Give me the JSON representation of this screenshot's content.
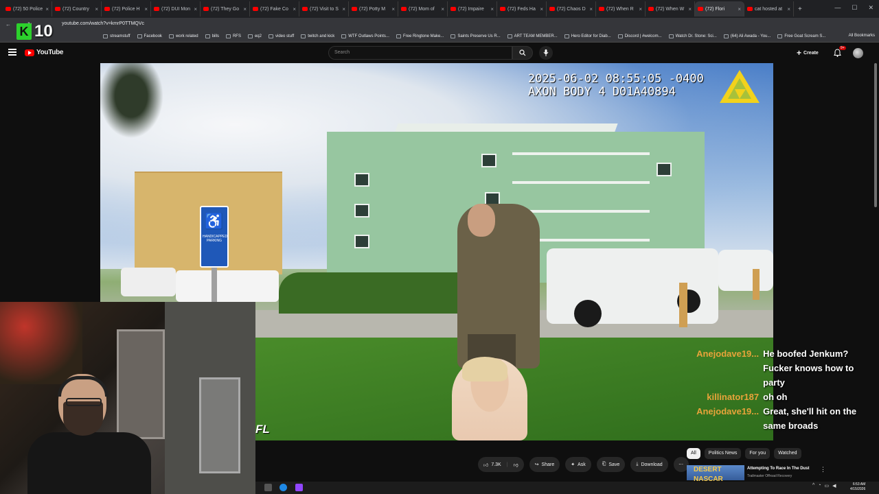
{
  "browser": {
    "tabs": [
      {
        "label": "(72) 50 Police",
        "active": false
      },
      {
        "label": "(72) Country",
        "active": false
      },
      {
        "label": "(72) Police H",
        "active": false
      },
      {
        "label": "(72) DUI Mon",
        "active": false
      },
      {
        "label": "(72) They Go",
        "active": false
      },
      {
        "label": "(72) Fake Co",
        "active": false
      },
      {
        "label": "(72) Visit to S",
        "active": false
      },
      {
        "label": "(72) Potty M",
        "active": false
      },
      {
        "label": "(72) Mom of",
        "active": false
      },
      {
        "label": "(72) Impaire",
        "active": false
      },
      {
        "label": "(72) Feds Ha",
        "active": false
      },
      {
        "label": "(72) Chaos D",
        "active": false
      },
      {
        "label": "(72) When R",
        "active": false
      },
      {
        "label": "(72) When W",
        "active": false
      },
      {
        "label": "(72) Flori",
        "active": true
      },
      {
        "label": "cat hosted at",
        "active": false
      }
    ],
    "url": "youtube.com/watch?v=kmrP0TTMQVc",
    "bookmarks": [
      "streamstuff",
      "Facebook",
      "work related",
      "bills",
      "RFS",
      "eq2",
      "video stuff",
      "twitch and kick",
      "WTF Outlaws Points...",
      "Free Ringtone Make...",
      "Saints Preserve Us R...",
      "ART TEAM MEMBER...",
      "Hero Editor for Diab...",
      "Discord | #welcom...",
      "Watch Dr. Stone: Sci...",
      "(64) Ali Awada - You...",
      "Free Goat Scream S..."
    ],
    "all_bookmarks": "All Bookmarks"
  },
  "youtube": {
    "logo": "YouTube",
    "search_placeholder": "Search",
    "create_label": "Create",
    "notif_count": "9+"
  },
  "video": {
    "timestamp": "2025-06-02 08:55:05 -0400",
    "device": "AXON BODY 4 D01A40894",
    "overlay_state": "FL",
    "sign_text": "HANDICAPPED PARKING"
  },
  "stream": {
    "channel_badge": "K",
    "channel_number": "10"
  },
  "chat": [
    {
      "name": "Anejodave19...",
      "name_color": "#e8a33a",
      "message": "He boofed Jenkum?"
    },
    {
      "name": "",
      "name_color": "#e8a33a",
      "message": "Fucker knows how to party"
    },
    {
      "name": "killinator187",
      "name_color": "#e8a33a",
      "message": "oh oh"
    },
    {
      "name": "Anejodave19...",
      "name_color": "#e8a33a",
      "message": "Great, she'll hit on the same broads"
    }
  ],
  "actions": {
    "likes": "7.3K",
    "share": "Share",
    "ask": "Ask",
    "save": "Save",
    "download": "Download"
  },
  "chips": [
    "All",
    "Politics News",
    "For you",
    "Watched"
  ],
  "recommendation": {
    "thumb_text": "DESERT NASCAR",
    "title": "Attempting To Race In The Dust",
    "channel": "Trailmaster Offroad Recovery"
  },
  "taskbar": {
    "time": "6:53 AM",
    "date": "4/15/2026"
  }
}
